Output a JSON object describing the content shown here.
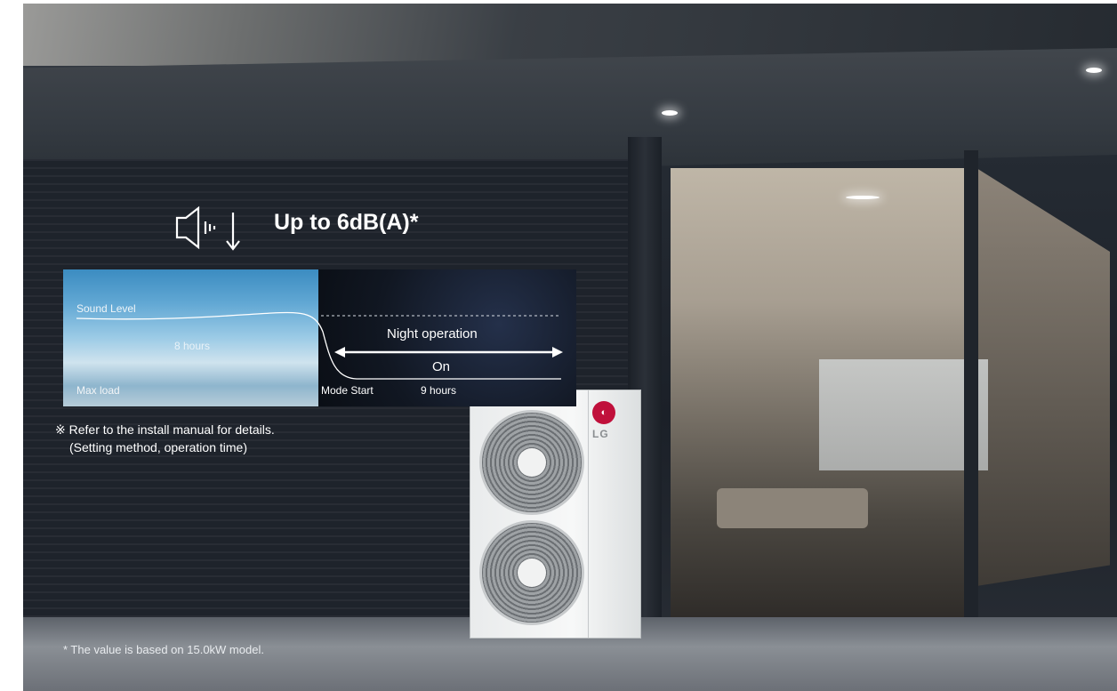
{
  "feature": {
    "headline": "Up to 6dB(A)*",
    "icon": "speaker-low-volume-icon",
    "chart": {
      "sound_level_label": "Sound Level",
      "day_duration": "8 hours",
      "night_operation_label": "Night operation",
      "on_label": "On",
      "max_load_label": "Max load",
      "mode_start_label": "Mode Start",
      "night_duration": "9 hours"
    },
    "note_line1": "※ Refer to the install manual for details.",
    "note_line2": "(Setting method, operation time)",
    "footnote": "* The value is based on 15.0kW model."
  },
  "product": {
    "brand": "LG"
  }
}
